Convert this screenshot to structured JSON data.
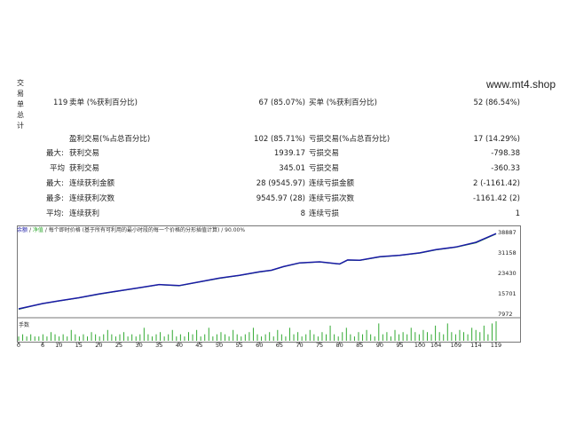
{
  "side_label": [
    "交",
    "易",
    "单",
    "总",
    "计"
  ],
  "watermark": "www.mt4.shop",
  "rows": [
    {
      "label": "119",
      "label_key": "卖单 (%获利百分比)",
      "mid_value": "67 (85.07%)",
      "right_key": "买单 (%获利百分比)",
      "right_value": "52 (86.54%)"
    },
    {
      "label": "",
      "label_key": "盈利交易(%占总百分比)",
      "mid_value": "102 (85.71%)",
      "right_key": "亏损交易(%占总百分比)",
      "right_value": "17 (14.29%)"
    },
    {
      "label": "最大:",
      "label_key": "获利交易",
      "mid_value": "1939.17",
      "right_key": "亏损交易",
      "right_value": "-798.38"
    },
    {
      "label": "平均",
      "label_key": "获利交易",
      "mid_value": "345.01",
      "right_key": "亏损交易",
      "right_value": "-360.33"
    },
    {
      "label": "最大:",
      "label_key": "连续获利金额",
      "mid_value": "28 (9545.97)",
      "right_key": "连续亏损金额",
      "right_value": "2 (-1161.42)"
    },
    {
      "label": "最多:",
      "label_key": "连续获利次数",
      "mid_value": "9545.97 (28)",
      "right_key": "连续亏损次数",
      "right_value": "-1161.42 (2)"
    },
    {
      "label": "平均:",
      "label_key": "连续获利",
      "mid_value": "8",
      "right_key": "连续亏损",
      "right_value": "1"
    }
  ],
  "chart_legend": "余额 / 净值 / 每个即时价格 (基于所有可利用的最小时段的每一个价格的分形插值计算) / 90.00%",
  "chart_legend_parts": {
    "balance": "余额",
    "equity": "净值",
    "note": "每个即时价格 (基于所有可利用的最小时段的每一个价格的分形插值计算) / 90.00%"
  },
  "volume_label": "手数",
  "chart_data": {
    "type": "line",
    "ylabels": [
      "38887",
      "31158",
      "23430",
      "15701",
      "7972"
    ],
    "yvalues": [
      38887,
      31158,
      23430,
      15701,
      7972
    ],
    "ylim": [
      7972,
      38887
    ],
    "xlabels": [
      "0",
      "6",
      "10",
      "15",
      "20",
      "25",
      "30",
      "35",
      "40",
      "45",
      "50",
      "55",
      "60",
      "65",
      "70",
      "75",
      "80",
      "85",
      "90",
      "95",
      "100",
      "104",
      "109",
      "114",
      "119"
    ],
    "xlim": [
      0,
      119
    ],
    "series": [
      {
        "name": "余额",
        "color": "#1a1aa6",
        "x": [
          0,
          3,
          6,
          10,
          15,
          20,
          25,
          30,
          35,
          40,
          45,
          50,
          55,
          60,
          63,
          66,
          70,
          75,
          80,
          82,
          85,
          90,
          95,
          100,
          104,
          109,
          114,
          119
        ],
        "y": [
          10000,
          11000,
          12000,
          13000,
          14200,
          15600,
          16800,
          18000,
          19200,
          18800,
          20200,
          21600,
          22700,
          24000,
          24600,
          26000,
          27400,
          27800,
          27000,
          28500,
          28400,
          29700,
          30300,
          31200,
          32400,
          33400,
          35200,
          38500
        ]
      },
      {
        "name": "净值",
        "color": "#33aa33",
        "x": [
          0,
          3,
          6,
          10,
          15,
          20,
          25,
          30,
          35,
          40,
          45,
          50,
          55,
          60,
          63,
          66,
          70,
          75,
          80,
          82,
          85,
          90,
          95,
          100,
          104,
          109,
          114,
          119
        ],
        "y": [
          9800,
          10900,
          11900,
          12900,
          14100,
          15500,
          16700,
          17900,
          19100,
          18700,
          20100,
          21500,
          22600,
          23900,
          24500,
          25900,
          27300,
          27700,
          26900,
          28400,
          28300,
          29600,
          30200,
          31100,
          32300,
          33300,
          35000,
          38300
        ]
      }
    ],
    "volume": [
      2,
      3,
      2,
      3,
      2,
      2,
      3,
      2,
      4,
      3,
      2,
      3,
      2,
      5,
      3,
      2,
      3,
      2,
      4,
      3,
      2,
      3,
      5,
      3,
      2,
      3,
      4,
      2,
      3,
      2,
      3,
      6,
      3,
      2,
      3,
      4,
      2,
      3,
      5,
      2,
      3,
      2,
      4,
      3,
      5,
      2,
      3,
      6,
      2,
      3,
      4,
      3,
      2,
      5,
      3,
      2,
      3,
      4,
      6,
      3,
      2,
      3,
      4,
      2,
      5,
      3,
      2,
      6,
      3,
      4,
      2,
      3,
      5,
      3,
      2,
      4,
      3,
      7,
      3,
      2,
      4,
      6,
      3,
      2,
      4,
      3,
      5,
      3,
      2,
      8,
      3,
      4,
      2,
      5,
      3,
      4,
      3,
      6,
      4,
      3,
      5,
      4,
      3,
      7,
      4,
      3,
      8,
      4,
      3,
      5,
      4,
      3,
      6,
      5,
      4,
      7,
      3,
      8,
      9
    ]
  }
}
